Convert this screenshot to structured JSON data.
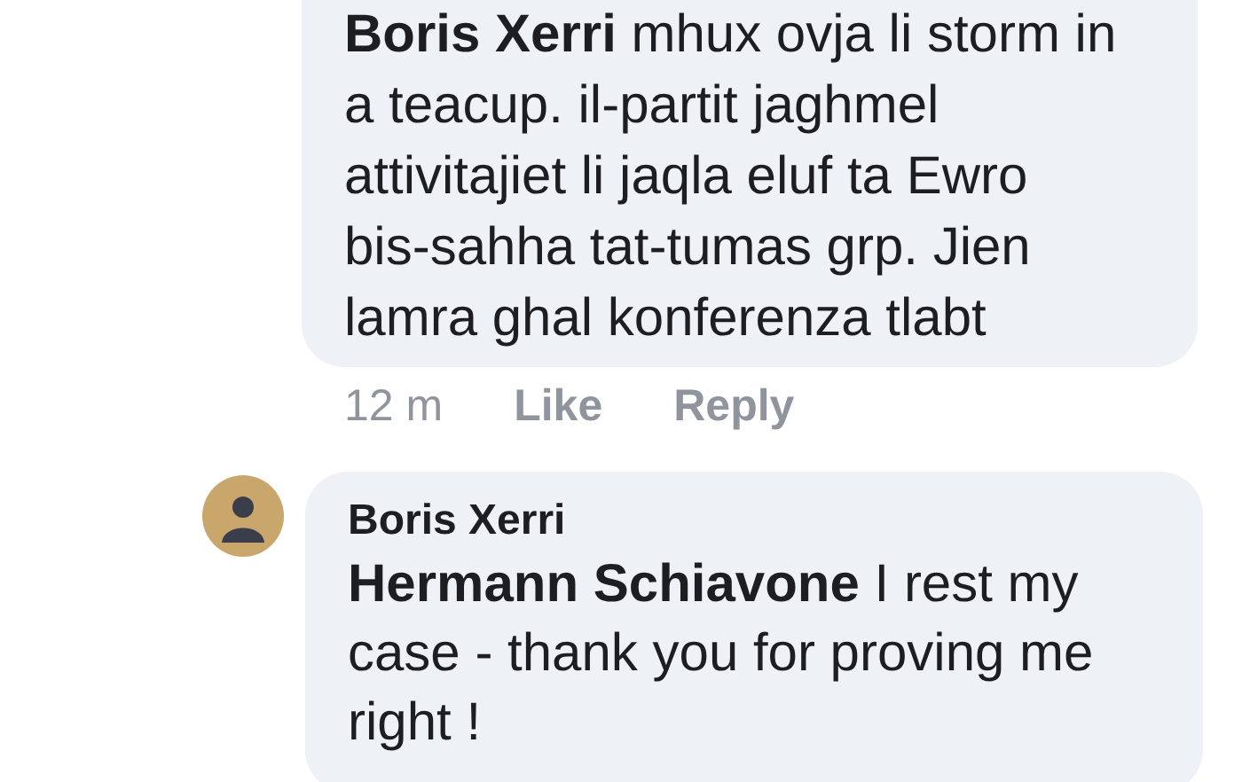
{
  "comments": [
    {
      "lines": [
        "**Boris Xerri** mhux ovja li storm in",
        "a teacup. il-partit jaghmel",
        "attivitajiet li jaqla eluf ta Ewro",
        "bis-sahha tat-tumas grp. Jien",
        "lamra ghal konferenza tlabt"
      ],
      "time": "12 m",
      "actions": [
        "Like",
        "Reply"
      ],
      "avatar": false
    },
    {
      "author": "Boris Xerri",
      "lines": [
        "**Hermann Schiavone** I rest my",
        "case - thank you for proving me",
        "right !"
      ],
      "avatar": true
    }
  ]
}
